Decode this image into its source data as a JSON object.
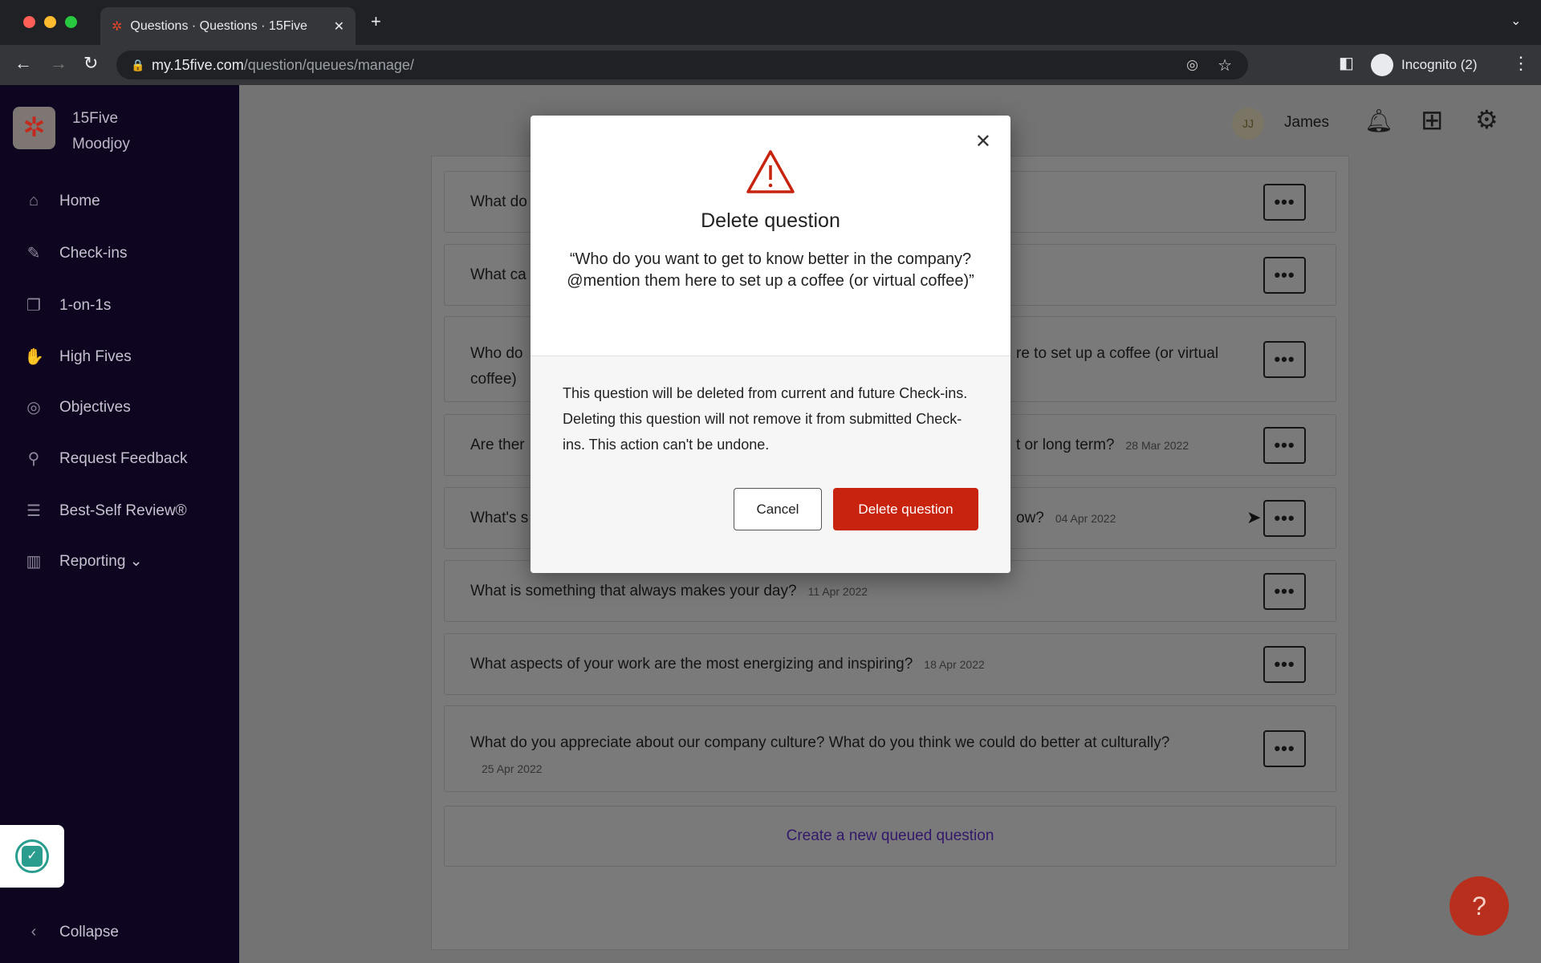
{
  "browser": {
    "tab_title": "Questions · Questions · 15Five",
    "url_domain": "my.15five.com",
    "url_path": "/question/queues/manage/",
    "profile": "Incognito (2)"
  },
  "sidebar": {
    "org_line1": "15Five",
    "org_line2": "Moodjoy",
    "items": [
      {
        "label": "Home",
        "icon": "home-icon"
      },
      {
        "label": "Check-ins",
        "icon": "checkin-icon"
      },
      {
        "label": "1-on-1s",
        "icon": "chat-icon"
      },
      {
        "label": "High Fives",
        "icon": "hand-icon"
      },
      {
        "label": "Objectives",
        "icon": "target-icon"
      },
      {
        "label": "Request Feedback",
        "icon": "feedback-icon"
      },
      {
        "label": "Best-Self Review®",
        "icon": "review-icon"
      },
      {
        "label": "Reporting ⌄",
        "icon": "chart-icon"
      }
    ],
    "collapse": "Collapse"
  },
  "header": {
    "avatar_initials": "JJ",
    "user_name": "James"
  },
  "questions": [
    {
      "text": "What do",
      "date": ""
    },
    {
      "text": "What ca",
      "date": ""
    },
    {
      "text": "Who do",
      "text_right": "re to set up a coffee (or virtual",
      "text2": "coffee)",
      "date": ""
    },
    {
      "text": "Are ther",
      "text_right": "t or long term?",
      "date": "28 Mar 2022"
    },
    {
      "text": "What's s",
      "text_right": "ow?",
      "date": "04 Apr 2022"
    },
    {
      "text": "What is something that always makes your day?",
      "date": "11 Apr 2022"
    },
    {
      "text": "What aspects of your work are the most energizing and inspiring?",
      "date": "18 Apr 2022"
    },
    {
      "text": "What do you appreciate about our company culture? What do you think we could do better at culturally?",
      "date": "25 Apr 2022"
    }
  ],
  "create_link": "Create a new queued question",
  "modal": {
    "title": "Delete question",
    "quote": "“Who do you want to get to know better in the company? @mention them here to set up a coffee (or virtual coffee)”",
    "body": "This question will be deleted from current and future Check-ins. Deleting this question will not remove it from submitted Check-ins. This action can't be undone.",
    "cancel": "Cancel",
    "confirm": "Delete question"
  },
  "colors": {
    "sidebar": "#0e0520",
    "danger": "#c8230e",
    "link": "#5a2bb5"
  }
}
